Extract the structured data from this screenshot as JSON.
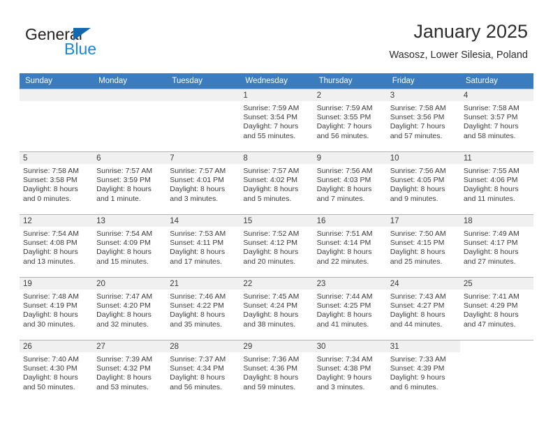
{
  "logo": {
    "word1": "General",
    "word2": "Blue",
    "triangle_color": "#1368b2",
    "blue_color": "#1787d9"
  },
  "header": {
    "month_title": "January 2025",
    "location": "Wasosz, Lower Silesia, Poland"
  },
  "calendar": {
    "header_bg": "#3a7cbe",
    "daynum_bg": "#f0f0f0",
    "weekdays": [
      "Sunday",
      "Monday",
      "Tuesday",
      "Wednesday",
      "Thursday",
      "Friday",
      "Saturday"
    ],
    "labels": {
      "sunrise": "Sunrise:",
      "sunset": "Sunset:",
      "daylight": "Daylight:"
    },
    "weeks": [
      [
        {
          "day": "",
          "empty": true
        },
        {
          "day": "",
          "empty": true
        },
        {
          "day": "",
          "empty": true
        },
        {
          "day": "1",
          "sunrise": "Sunrise: 7:59 AM",
          "sunset": "Sunset: 3:54 PM",
          "daylight1": "Daylight: 7 hours",
          "daylight2": "and 55 minutes."
        },
        {
          "day": "2",
          "sunrise": "Sunrise: 7:59 AM",
          "sunset": "Sunset: 3:55 PM",
          "daylight1": "Daylight: 7 hours",
          "daylight2": "and 56 minutes."
        },
        {
          "day": "3",
          "sunrise": "Sunrise: 7:58 AM",
          "sunset": "Sunset: 3:56 PM",
          "daylight1": "Daylight: 7 hours",
          "daylight2": "and 57 minutes."
        },
        {
          "day": "4",
          "sunrise": "Sunrise: 7:58 AM",
          "sunset": "Sunset: 3:57 PM",
          "daylight1": "Daylight: 7 hours",
          "daylight2": "and 58 minutes."
        }
      ],
      [
        {
          "day": "5",
          "sunrise": "Sunrise: 7:58 AM",
          "sunset": "Sunset: 3:58 PM",
          "daylight1": "Daylight: 8 hours",
          "daylight2": "and 0 minutes."
        },
        {
          "day": "6",
          "sunrise": "Sunrise: 7:57 AM",
          "sunset": "Sunset: 3:59 PM",
          "daylight1": "Daylight: 8 hours",
          "daylight2": "and 1 minute."
        },
        {
          "day": "7",
          "sunrise": "Sunrise: 7:57 AM",
          "sunset": "Sunset: 4:01 PM",
          "daylight1": "Daylight: 8 hours",
          "daylight2": "and 3 minutes."
        },
        {
          "day": "8",
          "sunrise": "Sunrise: 7:57 AM",
          "sunset": "Sunset: 4:02 PM",
          "daylight1": "Daylight: 8 hours",
          "daylight2": "and 5 minutes."
        },
        {
          "day": "9",
          "sunrise": "Sunrise: 7:56 AM",
          "sunset": "Sunset: 4:03 PM",
          "daylight1": "Daylight: 8 hours",
          "daylight2": "and 7 minutes."
        },
        {
          "day": "10",
          "sunrise": "Sunrise: 7:56 AM",
          "sunset": "Sunset: 4:05 PM",
          "daylight1": "Daylight: 8 hours",
          "daylight2": "and 9 minutes."
        },
        {
          "day": "11",
          "sunrise": "Sunrise: 7:55 AM",
          "sunset": "Sunset: 4:06 PM",
          "daylight1": "Daylight: 8 hours",
          "daylight2": "and 11 minutes."
        }
      ],
      [
        {
          "day": "12",
          "sunrise": "Sunrise: 7:54 AM",
          "sunset": "Sunset: 4:08 PM",
          "daylight1": "Daylight: 8 hours",
          "daylight2": "and 13 minutes."
        },
        {
          "day": "13",
          "sunrise": "Sunrise: 7:54 AM",
          "sunset": "Sunset: 4:09 PM",
          "daylight1": "Daylight: 8 hours",
          "daylight2": "and 15 minutes."
        },
        {
          "day": "14",
          "sunrise": "Sunrise: 7:53 AM",
          "sunset": "Sunset: 4:11 PM",
          "daylight1": "Daylight: 8 hours",
          "daylight2": "and 17 minutes."
        },
        {
          "day": "15",
          "sunrise": "Sunrise: 7:52 AM",
          "sunset": "Sunset: 4:12 PM",
          "daylight1": "Daylight: 8 hours",
          "daylight2": "and 20 minutes."
        },
        {
          "day": "16",
          "sunrise": "Sunrise: 7:51 AM",
          "sunset": "Sunset: 4:14 PM",
          "daylight1": "Daylight: 8 hours",
          "daylight2": "and 22 minutes."
        },
        {
          "day": "17",
          "sunrise": "Sunrise: 7:50 AM",
          "sunset": "Sunset: 4:15 PM",
          "daylight1": "Daylight: 8 hours",
          "daylight2": "and 25 minutes."
        },
        {
          "day": "18",
          "sunrise": "Sunrise: 7:49 AM",
          "sunset": "Sunset: 4:17 PM",
          "daylight1": "Daylight: 8 hours",
          "daylight2": "and 27 minutes."
        }
      ],
      [
        {
          "day": "19",
          "sunrise": "Sunrise: 7:48 AM",
          "sunset": "Sunset: 4:19 PM",
          "daylight1": "Daylight: 8 hours",
          "daylight2": "and 30 minutes."
        },
        {
          "day": "20",
          "sunrise": "Sunrise: 7:47 AM",
          "sunset": "Sunset: 4:20 PM",
          "daylight1": "Daylight: 8 hours",
          "daylight2": "and 32 minutes."
        },
        {
          "day": "21",
          "sunrise": "Sunrise: 7:46 AM",
          "sunset": "Sunset: 4:22 PM",
          "daylight1": "Daylight: 8 hours",
          "daylight2": "and 35 minutes."
        },
        {
          "day": "22",
          "sunrise": "Sunrise: 7:45 AM",
          "sunset": "Sunset: 4:24 PM",
          "daylight1": "Daylight: 8 hours",
          "daylight2": "and 38 minutes."
        },
        {
          "day": "23",
          "sunrise": "Sunrise: 7:44 AM",
          "sunset": "Sunset: 4:25 PM",
          "daylight1": "Daylight: 8 hours",
          "daylight2": "and 41 minutes."
        },
        {
          "day": "24",
          "sunrise": "Sunrise: 7:43 AM",
          "sunset": "Sunset: 4:27 PM",
          "daylight1": "Daylight: 8 hours",
          "daylight2": "and 44 minutes."
        },
        {
          "day": "25",
          "sunrise": "Sunrise: 7:41 AM",
          "sunset": "Sunset: 4:29 PM",
          "daylight1": "Daylight: 8 hours",
          "daylight2": "and 47 minutes."
        }
      ],
      [
        {
          "day": "26",
          "sunrise": "Sunrise: 7:40 AM",
          "sunset": "Sunset: 4:30 PM",
          "daylight1": "Daylight: 8 hours",
          "daylight2": "and 50 minutes."
        },
        {
          "day": "27",
          "sunrise": "Sunrise: 7:39 AM",
          "sunset": "Sunset: 4:32 PM",
          "daylight1": "Daylight: 8 hours",
          "daylight2": "and 53 minutes."
        },
        {
          "day": "28",
          "sunrise": "Sunrise: 7:37 AM",
          "sunset": "Sunset: 4:34 PM",
          "daylight1": "Daylight: 8 hours",
          "daylight2": "and 56 minutes."
        },
        {
          "day": "29",
          "sunrise": "Sunrise: 7:36 AM",
          "sunset": "Sunset: 4:36 PM",
          "daylight1": "Daylight: 8 hours",
          "daylight2": "and 59 minutes."
        },
        {
          "day": "30",
          "sunrise": "Sunrise: 7:34 AM",
          "sunset": "Sunset: 4:38 PM",
          "daylight1": "Daylight: 9 hours",
          "daylight2": "and 3 minutes."
        },
        {
          "day": "31",
          "sunrise": "Sunrise: 7:33 AM",
          "sunset": "Sunset: 4:39 PM",
          "daylight1": "Daylight: 9 hours",
          "daylight2": "and 6 minutes."
        },
        {
          "day": "",
          "blank": true
        }
      ]
    ]
  }
}
